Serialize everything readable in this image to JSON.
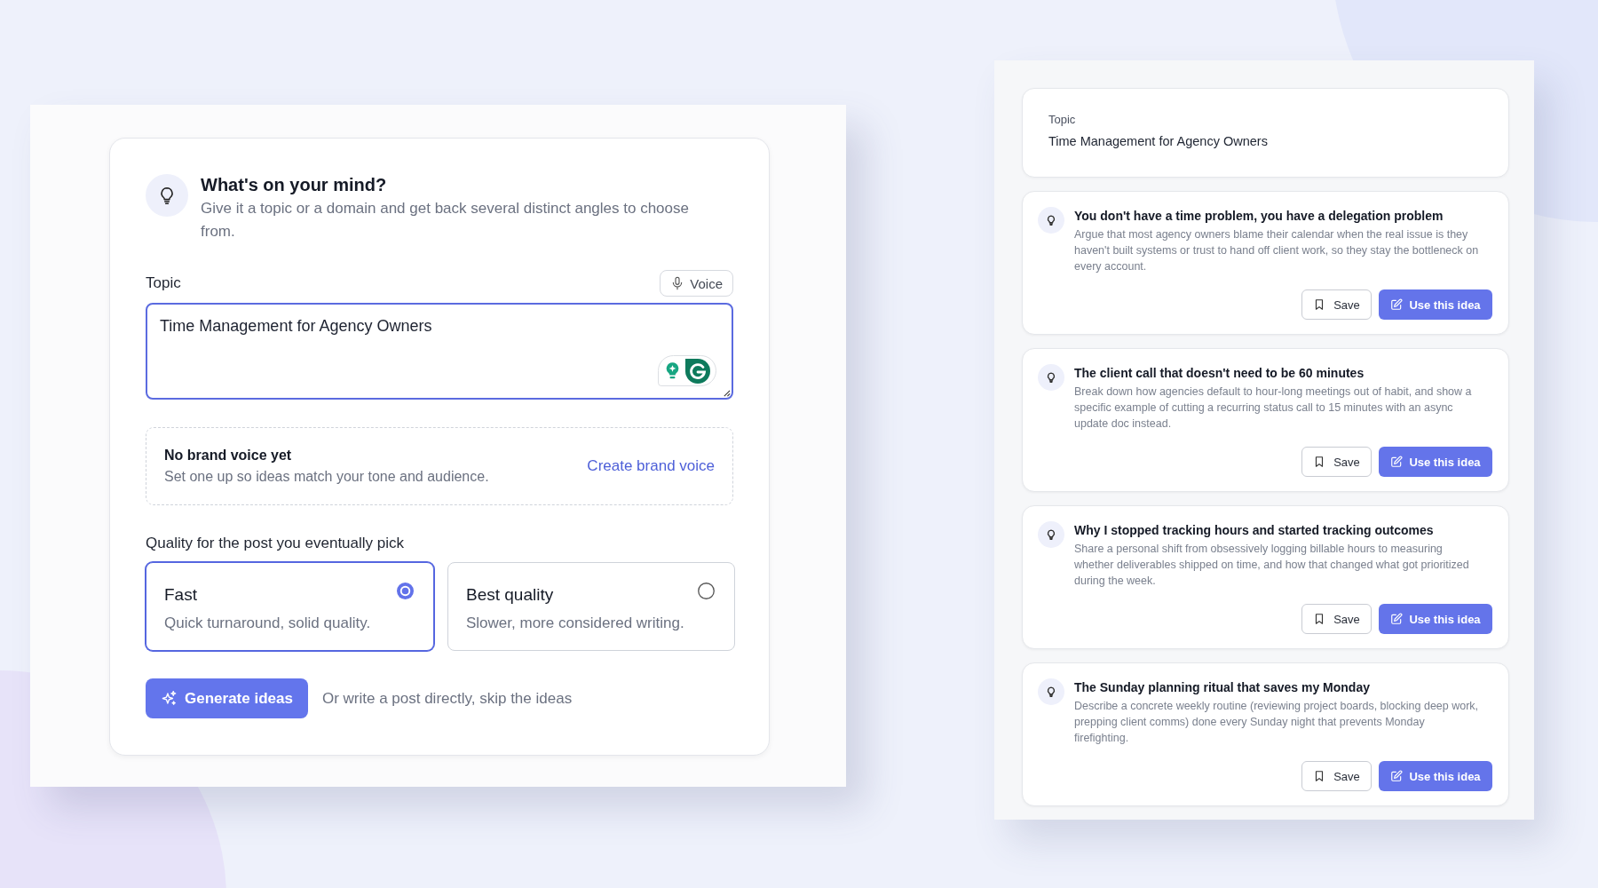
{
  "composer": {
    "heading": "What's on your mind?",
    "subtitle": "Give it a topic or a domain and get back several distinct angles to choose from.",
    "topic_label": "Topic",
    "voice_button": "Voice",
    "topic_value": "Time Management for Agency Owners",
    "brand_voice": {
      "title": "No brand voice yet",
      "text": "Set one up so ideas match your tone and audience.",
      "link": "Create brand voice"
    },
    "quality_label": "Quality for the post you eventually pick",
    "quality_options": [
      {
        "title": "Fast",
        "description": "Quick turnaround, solid quality.",
        "selected": true
      },
      {
        "title": "Best quality",
        "description": "Slower, more considered writing.",
        "selected": false
      }
    ],
    "generate_button": "Generate ideas",
    "skip_text": "Or write a post directly, skip the ideas"
  },
  "results": {
    "topic_label": "Topic",
    "topic_value": "Time Management for Agency Owners",
    "ideas": [
      {
        "title": "You don't have a time problem, you have a delegation problem",
        "description": "Argue that most agency owners blame their calendar when the real issue is they haven't built systems or trust to hand off client work, so they stay the bottleneck on every account.",
        "save_button": "Save",
        "use_button": "Use this idea"
      },
      {
        "title": "The client call that doesn't need to be 60 minutes",
        "description": "Break down how agencies default to hour-long meetings out of habit, and show a specific example of cutting a recurring status call to 15 minutes with an async update doc instead.",
        "save_button": "Save",
        "use_button": "Use this idea"
      },
      {
        "title": "Why I stopped tracking hours and started tracking outcomes",
        "description": "Share a personal shift from obsessively logging billable hours to measuring whether deliverables shipped on time, and how that changed what got prioritized during the week.",
        "save_button": "Save",
        "use_button": "Use this idea"
      },
      {
        "title": "The Sunday planning ritual that saves my Monday",
        "description": "Describe a concrete weekly routine (reviewing project boards, blocking deep work, prepping client comms) done every Sunday night that prevents Monday firefighting.",
        "save_button": "Save",
        "use_button": "Use this idea"
      }
    ]
  }
}
